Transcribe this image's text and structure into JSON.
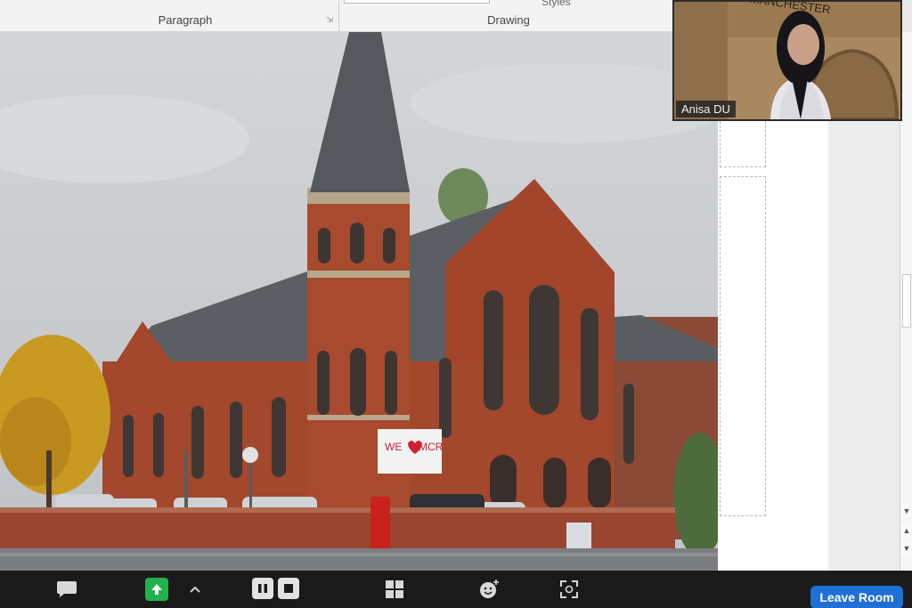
{
  "ribbon": {
    "groups": [
      {
        "label": "Paragraph"
      },
      {
        "label": "Drawing"
      }
    ],
    "styles_label": "Styles"
  },
  "participant": {
    "name": "Anisa DU",
    "sign_text": "MANCHESTER"
  },
  "slide_photo": {
    "poster_text_we": "WE",
    "poster_text_mcr": "MCR"
  },
  "toolbar": {
    "leave_label": "Leave Room",
    "icons": [
      "chat-icon",
      "share-screen-icon",
      "chevron-up-icon",
      "pause-icon",
      "stop-icon",
      "apps-grid-icon",
      "reactions-icon",
      "fullscreen-icon"
    ]
  },
  "colors": {
    "toolbar_bg": "#1a1a1a",
    "share_green": "#23b14d",
    "leave_blue": "#1f6fd6",
    "brick": "#a2452b"
  }
}
